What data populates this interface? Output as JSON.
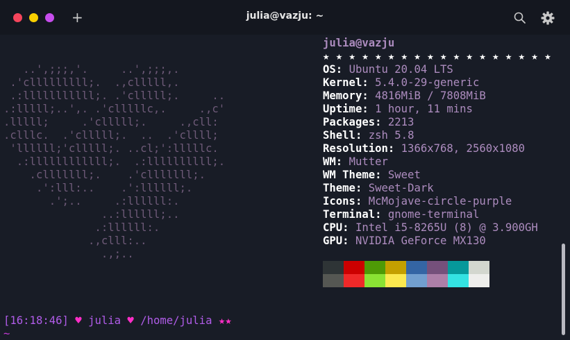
{
  "window": {
    "title": "julia@vazju: ~",
    "new_tab_label": "+"
  },
  "ascii_logo": [
    "   ..',;;;,'.     ..',;;;,.",
    " .'clllllllll;.  .,clllll,.",
    " .:lllllllllll;. .'clllll;.     ..",
    ".:lllll;..',. .'clllllc,.     .,c'",
    ".lllll;     .'clllll;.     .,cll:",
    ".clllc.  .'clllll;.  ..  .'cllll;",
    " 'llllll;'clllll;. ..cl;':lllllc.",
    "  .:llllllllllll;.  .:llllllllll;.",
    "    .clllllll;.    .'clllllll;.",
    "     .':lll:..    .':llllll;.",
    "       .';..     .:llllll:.",
    "               ..:llllll;..",
    "              .:llllll:.",
    "             .,clll:..",
    "               .,;.."
  ],
  "info": {
    "user_host": "julia@vazju",
    "separator": "★ ★ ★ ★ ★ ★ ★ ★ ★ ★ ★ ★ ★ ★ ★ ★ ★ ★",
    "rows": [
      {
        "key": "OS",
        "value": "Ubuntu 20.04 LTS"
      },
      {
        "key": "Kernel",
        "value": "5.4.0-29-generic"
      },
      {
        "key": "Memory",
        "value": "4816MiB / 7808MiB"
      },
      {
        "key": "Uptime",
        "value": "1 hour, 11 mins"
      },
      {
        "key": "Packages",
        "value": "2213"
      },
      {
        "key": "Shell",
        "value": "zsh 5.8"
      },
      {
        "key": "Resolution",
        "value": "1366x768, 2560x1080"
      },
      {
        "key": "WM",
        "value": "Mutter"
      },
      {
        "key": "WM Theme",
        "value": "Sweet"
      },
      {
        "key": "Theme",
        "value": "Sweet-Dark"
      },
      {
        "key": "Icons",
        "value": "McMojave-circle-purple"
      },
      {
        "key": "Terminal",
        "value": "gnome-terminal"
      },
      {
        "key": "CPU",
        "value": "Intel i5-8265U (8) @ 3.900GH"
      },
      {
        "key": "GPU",
        "value": "NVIDIA GeForce MX130"
      }
    ],
    "colon": ":"
  },
  "palette": {
    "normal": [
      "#2e3436",
      "#cc0000",
      "#4e9a06",
      "#c4a000",
      "#3465a4",
      "#75507b",
      "#06989a",
      "#d3d7cf"
    ],
    "bright": [
      "#555753",
      "#ef2929",
      "#8ae234",
      "#fce94f",
      "#729fcf",
      "#ad7fa8",
      "#34e2e2",
      "#eeeeec"
    ]
  },
  "prompt": {
    "time": "[16:18:46]",
    "heart1": "♥",
    "name": "julia",
    "heart2": "♥",
    "path": "/home/julia",
    "stars": "★★",
    "cursor": "~"
  }
}
